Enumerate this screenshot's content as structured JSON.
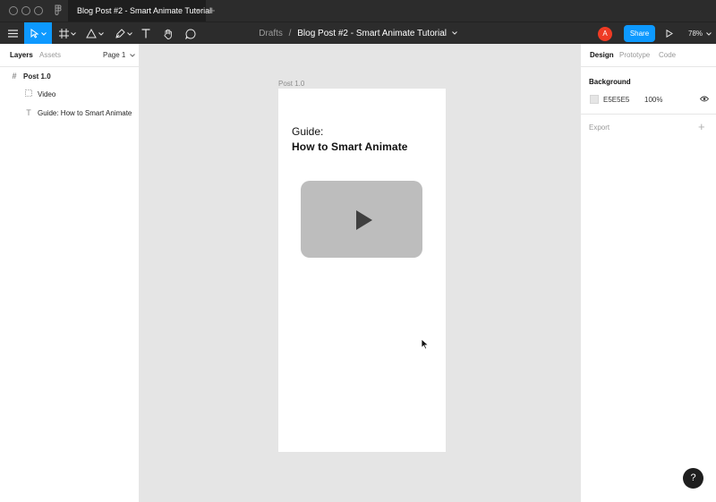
{
  "title_tab": {
    "doc_title": "Blog Post #2 - Smart Animate Tutorial",
    "close": "×",
    "add": "+"
  },
  "toolbar": {
    "breadcrumb_root": "Drafts",
    "separator": "/",
    "file_name": "Blog Post #2 - Smart Animate Tutorial",
    "avatar_initial": "A",
    "share_label": "Share",
    "zoom": "78%",
    "accent_color": "#0d99ff",
    "avatar_color": "#ef3b24"
  },
  "left_panel": {
    "tabs": [
      {
        "label": "Layers"
      },
      {
        "label": "Assets"
      }
    ],
    "page_select": "Page 1",
    "layers": [
      {
        "label": "Post 1.0",
        "icon": "frame-icon"
      },
      {
        "label": "Video",
        "icon": "rectangle-icon"
      },
      {
        "label": "Guide: How to Smart Animate",
        "icon": "text-icon"
      }
    ]
  },
  "canvas": {
    "frame_label": "Post 1.0",
    "heading_line1": "Guide:",
    "heading_line2": "How to Smart Animate"
  },
  "right_panel": {
    "tabs": [
      {
        "label": "Design"
      },
      {
        "label": "Prototype"
      },
      {
        "label": "Code"
      }
    ],
    "background_title": "Background",
    "background_hex": "E5E5E5",
    "background_opacity": "100%",
    "export_title": "Export",
    "export_add": "+"
  },
  "help": "?"
}
